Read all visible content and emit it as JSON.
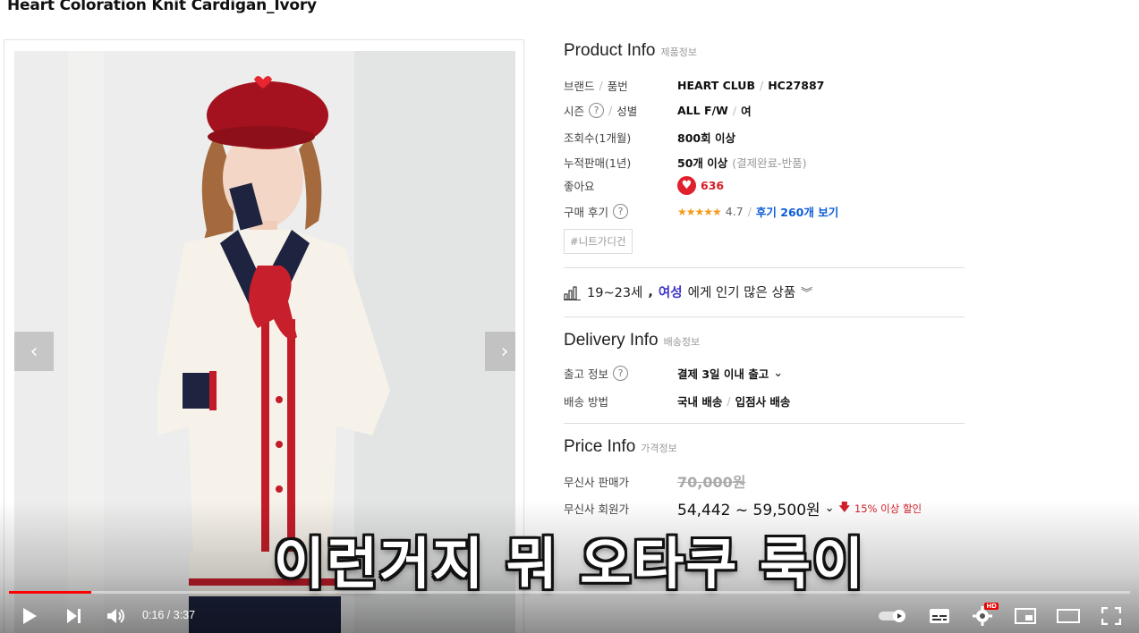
{
  "product": {
    "title": "Heart Coloration Knit Cardigan_Ivory",
    "prev_arrow": "‹",
    "next_arrow": "›"
  },
  "product_info": {
    "title": "Product Info",
    "subtitle": "제품정보",
    "brand_label": "브랜드",
    "product_no_label": "품번",
    "brand": "HEART CLUB",
    "product_no": "HC27887",
    "season_label": "시즌",
    "gender_label": "성별",
    "season": "ALL F/W",
    "gender": "여",
    "views_label": "조회수(1개월)",
    "views": "800회 이상",
    "sales_label": "누적판매(1년)",
    "sales": "50개 이상",
    "sales_note": "(결제완료-반품)",
    "likes_label": "좋아요",
    "likes": "636",
    "reviews_label": "구매 후기",
    "stars": "★★★★★",
    "rating": "4.7",
    "reviews_link": "후기 260개 보기",
    "tag": "#니트가디건"
  },
  "popular": {
    "age": "19~23세",
    "comma": ",",
    "gender": "여성",
    "text": "에게 인기 많은 상품"
  },
  "delivery_info": {
    "title": "Delivery Info",
    "subtitle": "배송정보",
    "release_label": "출고 정보",
    "release": "결제 3일 이내 출고",
    "method_label": "배송 방법",
    "method_1": "국내 배송",
    "method_2": "입점사 배송"
  },
  "price_info": {
    "title": "Price Info",
    "subtitle": "가격정보",
    "sale_price_label": "무신사 판매가",
    "sale_price": "70,000원",
    "member_price_label": "무신사 회원가",
    "member_price": "54,442 ~ 59,500원",
    "discount": "15% 이상 할인"
  },
  "caption": "이런거지 뭐 오타쿠 룩이",
  "player": {
    "time": "0:16 / 3:37",
    "progress_fraction": 0.0737,
    "buffer_fraction": 0.0
  },
  "colors": {
    "accent_red": "#d31f2a",
    "link_blue": "#0d5dd6",
    "progress_red": "#ff0000"
  }
}
